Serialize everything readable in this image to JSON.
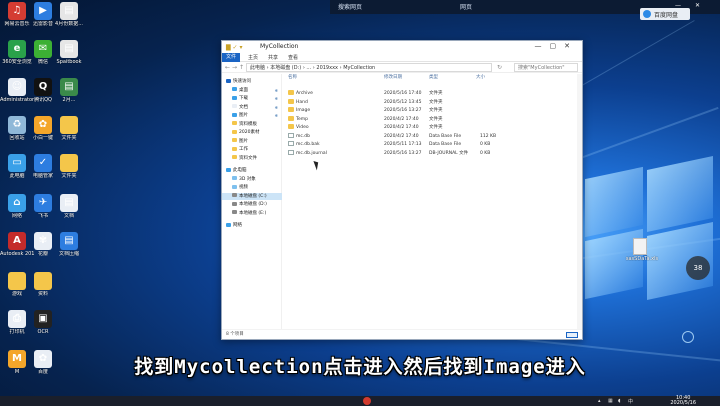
{
  "top_window": {
    "left_text": "搜索网页",
    "right_text": "网页",
    "cloud_label": "百度网盘",
    "controls": [
      "—",
      "✕"
    ]
  },
  "desktop_icons": [
    {
      "label": "网易云音乐",
      "color": "#d43c33",
      "glyph": "♫"
    },
    {
      "label": "迅雷影音",
      "color": "#2d7de0",
      "glyph": "▶"
    },
    {
      "label": "4月份数据...",
      "color": "#e6e6e6",
      "glyph": "▤"
    },
    {
      "label": "360安全浏览",
      "color": "#2aa14a",
      "glyph": "e"
    },
    {
      "label": "微信",
      "color": "#3cb034",
      "glyph": "✉"
    },
    {
      "label": "Spaitbook",
      "color": "#e6e6e6",
      "glyph": "▤"
    },
    {
      "label": "Administrator",
      "color": "#e9eef5",
      "glyph": "☺"
    },
    {
      "label": "腾讯QQ",
      "color": "#111111",
      "glyph": "Q"
    },
    {
      "label": "2月...",
      "color": "#3a8a4a",
      "glyph": "▤"
    },
    {
      "label": "回收站",
      "color": "#8fb8d8",
      "glyph": "♻"
    },
    {
      "label": "小白一键",
      "color": "#f4a62a",
      "glyph": "✿"
    },
    {
      "label": "文件夹",
      "color": "#f4c64a",
      "glyph": ""
    },
    {
      "label": "此电脑",
      "color": "#3aa0e8",
      "glyph": "▭"
    },
    {
      "label": "电脑管家",
      "color": "#2d7de0",
      "glyph": "✓"
    },
    {
      "label": "文件夹",
      "color": "#f4c64a",
      "glyph": ""
    },
    {
      "label": "网络",
      "color": "#3aa0e8",
      "glyph": "⌂"
    },
    {
      "label": "飞书",
      "color": "#2d7de0",
      "glyph": "✈"
    },
    {
      "label": "文档",
      "color": "#e9eef5",
      "glyph": "▤"
    },
    {
      "label": "Autodesk 2019",
      "color": "#c42b2b",
      "glyph": "A"
    },
    {
      "label": "花瓣",
      "color": "#e9eef5",
      "glyph": "✾"
    },
    {
      "label": "文档压缩",
      "color": "#2d7de0",
      "glyph": "▤"
    },
    {
      "label": "游戏",
      "color": "#f4c64a",
      "glyph": ""
    },
    {
      "label": "资料",
      "color": "#f4c64a",
      "glyph": ""
    },
    {
      "label": "打印机",
      "color": "#e9eef5",
      "glyph": "⎙"
    },
    {
      "label": "OCR",
      "color": "#222222",
      "glyph": "▣"
    },
    {
      "label": "M",
      "color": "#f4a62a",
      "glyph": "M"
    },
    {
      "label": "百度",
      "color": "#e9eef5",
      "glyph": "✿"
    }
  ],
  "explorer": {
    "title": "MyCollection",
    "ribbon_tabs": [
      "文件",
      "主页",
      "共享",
      "查看"
    ],
    "address_parts": [
      "此电脑",
      "本地磁盘 (D:)",
      "...",
      "2019xxx",
      "MyCollection"
    ],
    "search_placeholder": "搜索\"MyCollection\"",
    "nav_items": [
      {
        "label": "快速访问",
        "color": "#1a64c4",
        "selected": false
      },
      {
        "label": "桌面",
        "color": "#3aa0e8",
        "selected": false
      },
      {
        "label": "下载",
        "color": "#3aa0e8",
        "selected": false
      },
      {
        "label": "文档",
        "color": "#e9eef5",
        "selected": false
      },
      {
        "label": "图片",
        "color": "#3aa0e8",
        "selected": false
      },
      {
        "label": "资料模板",
        "color": "#f4c64a",
        "selected": false
      },
      {
        "label": "2020素材",
        "color": "#f4c64a",
        "selected": false
      },
      {
        "label": "图片",
        "color": "#f4c64a",
        "selected": false
      },
      {
        "label": "工作",
        "color": "#f4c64a",
        "selected": false
      },
      {
        "label": "资料文件",
        "color": "#f4c64a",
        "selected": false
      },
      {
        "label": "此电脑",
        "color": "#3aa0e8",
        "selected": false
      },
      {
        "label": "3D 对象",
        "color": "#7ec0ee",
        "selected": false
      },
      {
        "label": "视频",
        "color": "#7ec0ee",
        "selected": false
      },
      {
        "label": "本地磁盘 (C:)",
        "color": "#888888",
        "selected": true
      },
      {
        "label": "本地磁盘 (D:)",
        "color": "#888888",
        "selected": false
      },
      {
        "label": "本地磁盘 (E:)",
        "color": "#888888",
        "selected": false
      },
      {
        "label": "网络",
        "color": "#3aa0e8",
        "selected": false
      }
    ],
    "columns": [
      "名称",
      "修改日期",
      "类型",
      "大小"
    ],
    "files": [
      {
        "name": "Archive",
        "date": "2020/5/16 17:40",
        "type": "文件夹",
        "size": "",
        "kind": "folder"
      },
      {
        "name": "Hand",
        "date": "2020/5/12 13:45",
        "type": "文件夹",
        "size": "",
        "kind": "folder"
      },
      {
        "name": "Image",
        "date": "2020/5/16 13:27",
        "type": "文件夹",
        "size": "",
        "kind": "folder"
      },
      {
        "name": "Temp",
        "date": "2020/4/2 17:40",
        "type": "文件夹",
        "size": "",
        "kind": "folder"
      },
      {
        "name": "Video",
        "date": "2020/4/2 17:40",
        "type": "文件夹",
        "size": "",
        "kind": "folder"
      },
      {
        "name": "mc.db",
        "date": "2020/4/2 17:40",
        "type": "Data Base File",
        "size": "112 KB",
        "kind": "file"
      },
      {
        "name": "mc.db.bak",
        "date": "2020/5/11 17:13",
        "type": "Data Base File",
        "size": "0 KB",
        "kind": "file"
      },
      {
        "name": "mc.db.journal",
        "date": "2020/5/16 13:27",
        "type": "DB-JOURNAL 文件",
        "size": "0 KB",
        "kind": "file"
      }
    ],
    "status": "8 个项目"
  },
  "right_file": {
    "label": "sasSDaTa.xls",
    "badge": "38"
  },
  "subtitle": "找到Mycollection点击进入然后找到Image进入",
  "taskbar": {
    "time": "10:40",
    "date": "2020/5/16"
  }
}
